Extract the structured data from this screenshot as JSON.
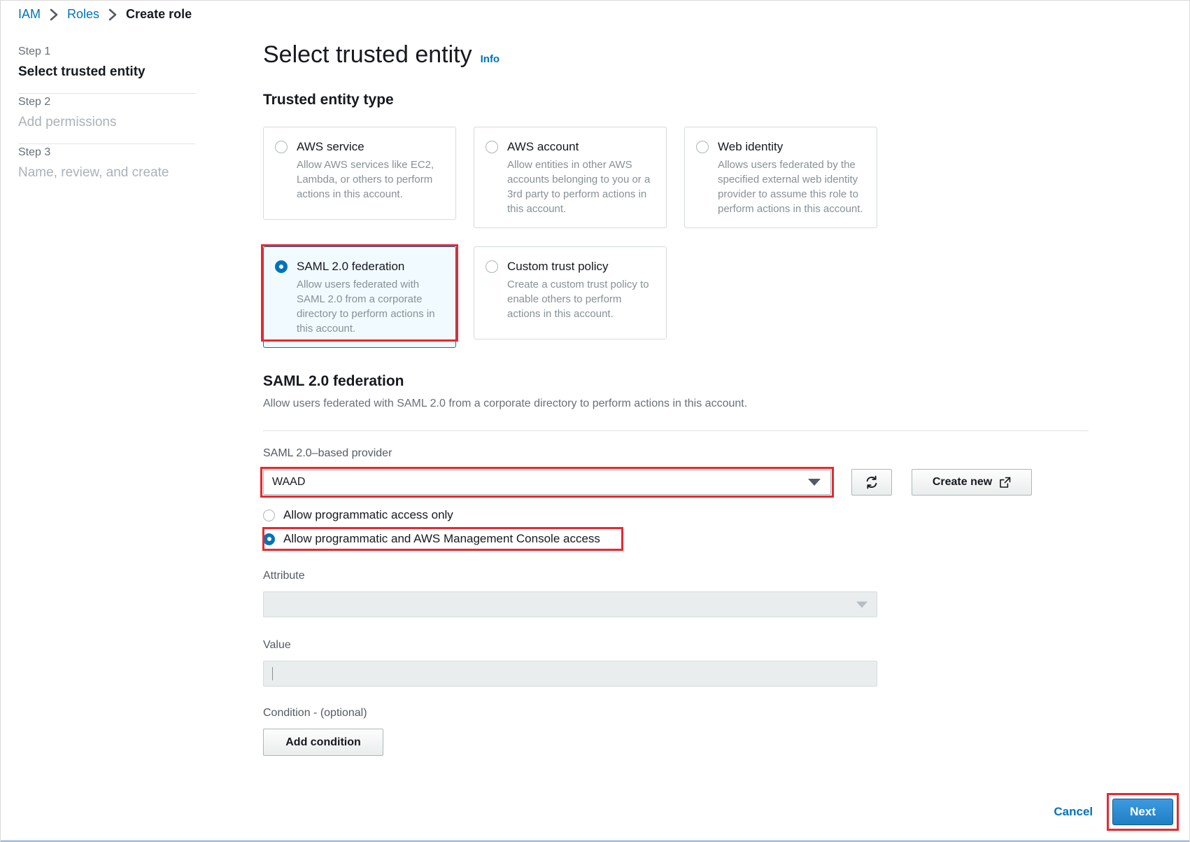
{
  "breadcrumb": {
    "items": [
      {
        "label": "IAM",
        "current": false
      },
      {
        "label": "Roles",
        "current": false
      },
      {
        "label": "Create role",
        "current": true
      }
    ]
  },
  "stepper": {
    "steps": [
      {
        "num": "Step 1",
        "name": "Select trusted entity",
        "state": "active"
      },
      {
        "num": "Step 2",
        "name": "Add permissions",
        "state": "inactive"
      },
      {
        "num": "Step 3",
        "name": "Name, review, and create",
        "state": "inactive"
      }
    ]
  },
  "header": {
    "title": "Select trusted entity",
    "info_label": "Info"
  },
  "trusted_entity": {
    "heading": "Trusted entity type",
    "tiles": [
      {
        "label": "AWS service",
        "desc": "Allow AWS services like EC2, Lambda, or others to perform actions in this account.",
        "selected": false
      },
      {
        "label": "AWS account",
        "desc": "Allow entities in other AWS accounts belonging to you or a 3rd party to perform actions in this account.",
        "selected": false
      },
      {
        "label": "Web identity",
        "desc": "Allows users federated by the specified external web identity provider to assume this role to perform actions in this account.",
        "selected": false
      },
      {
        "label": "SAML 2.0 federation",
        "desc": "Allow users federated with SAML 2.0 from a corporate directory to perform actions in this account.",
        "selected": true
      },
      {
        "label": "Custom trust policy",
        "desc": "Create a custom trust policy to enable others to perform actions in this account.",
        "selected": false
      }
    ]
  },
  "saml_section": {
    "heading": "SAML 2.0 federation",
    "description": "Allow users federated with SAML 2.0 from a corporate directory to perform actions in this account.",
    "provider_label": "SAML 2.0–based provider",
    "provider_value": "WAAD",
    "refresh_icon": "refresh-icon",
    "create_new_label": "Create new",
    "external_link_icon": "external-link-icon",
    "access_options": [
      {
        "label": "Allow programmatic access only",
        "selected": false
      },
      {
        "label": "Allow programmatic and AWS Management Console access",
        "selected": true
      }
    ],
    "attribute_label": "Attribute",
    "attribute_value": "",
    "value_label": "Value",
    "value_value": "",
    "condition_label": "Condition - (optional)",
    "add_condition_label": "Add condition"
  },
  "footer": {
    "cancel_label": "Cancel",
    "next_label": "Next"
  },
  "colors": {
    "link": "#0073bb",
    "annotation": "#e8292f",
    "selected_tile_bg": "#f1faff",
    "primary_button": "#1f7fc4"
  }
}
